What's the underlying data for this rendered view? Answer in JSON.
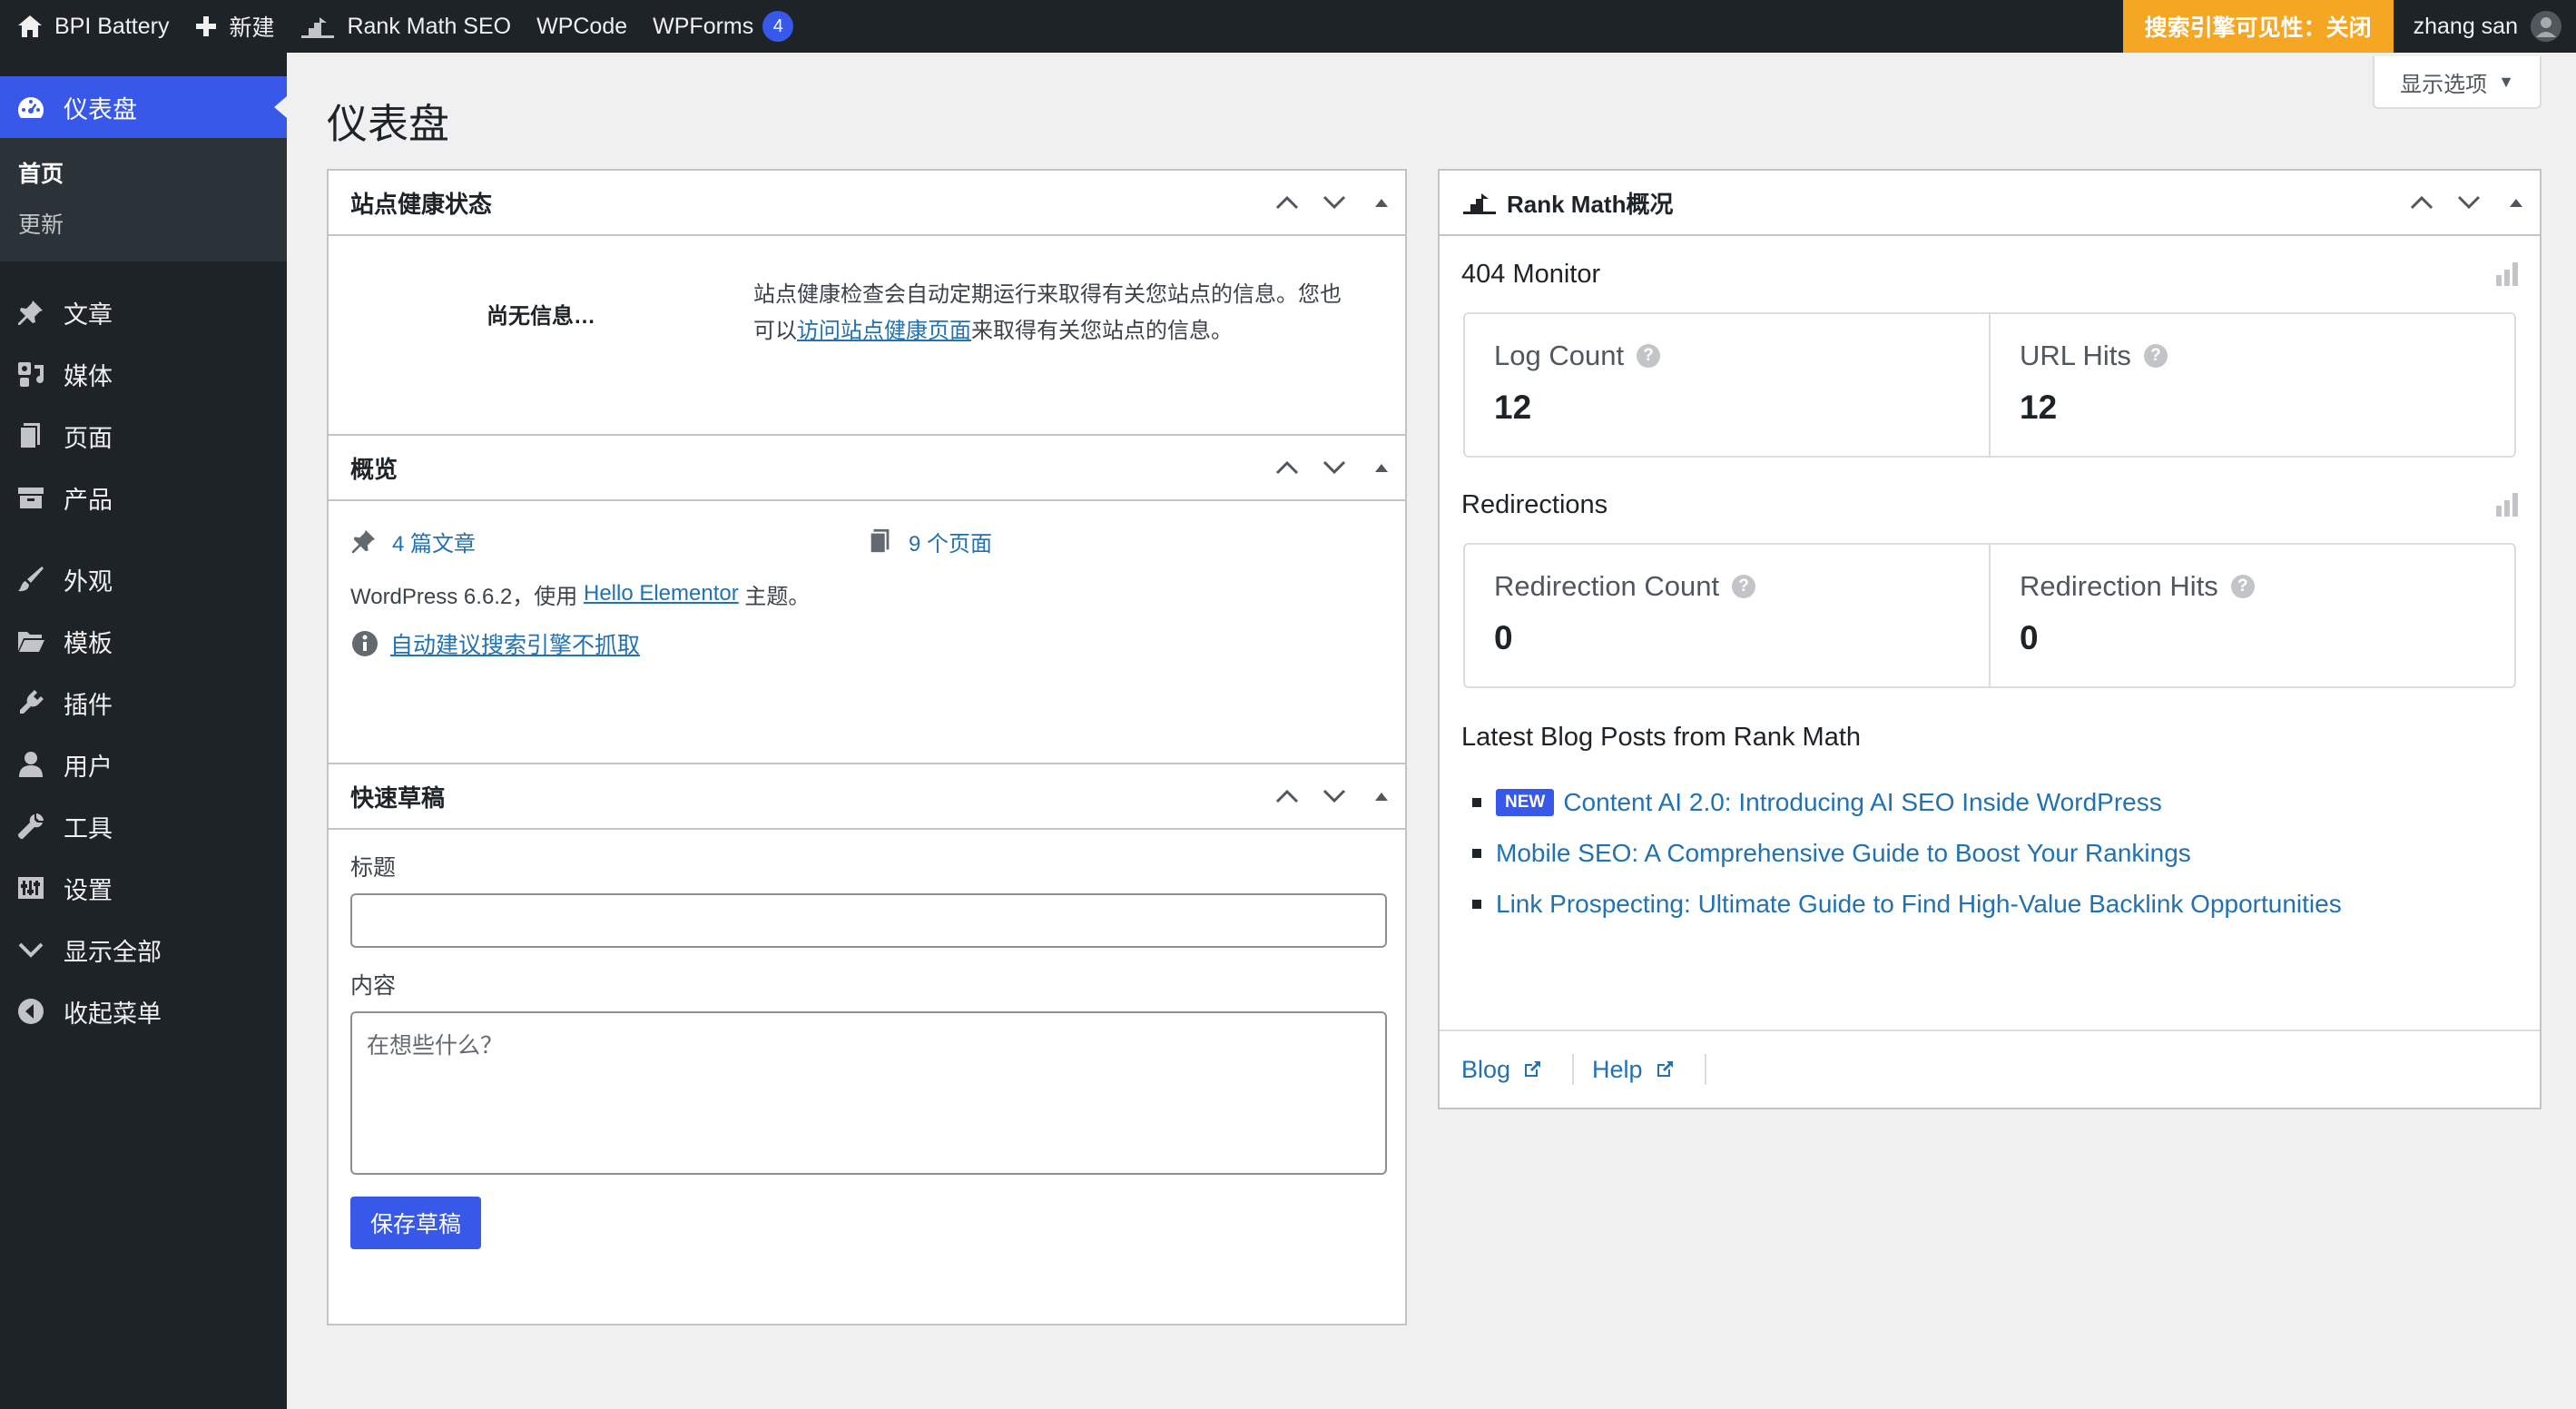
{
  "adminbar": {
    "site_name": "BPI Battery",
    "new_label": "新建",
    "rank_math_label": "Rank Math SEO",
    "wpcode_label": "WPCode",
    "wpforms_label": "WPForms",
    "wpforms_count": "4",
    "seo_visibility": "搜索引擎可见性：关闭",
    "user_name": "zhang san"
  },
  "sidebar": {
    "dashboard": "仪表盘",
    "sub_home": "首页",
    "sub_updates": "更新",
    "items": [
      {
        "label": "文章",
        "icon": "pin-icon"
      },
      {
        "label": "媒体",
        "icon": "media-icon"
      },
      {
        "label": "页面",
        "icon": "pages-icon"
      },
      {
        "label": "产品",
        "icon": "archive-icon"
      },
      {
        "label": "外观",
        "icon": "brush-icon"
      },
      {
        "label": "模板",
        "icon": "folder-icon"
      },
      {
        "label": "插件",
        "icon": "plugin-icon"
      },
      {
        "label": "用户",
        "icon": "user-icon"
      },
      {
        "label": "工具",
        "icon": "wrench-icon"
      },
      {
        "label": "设置",
        "icon": "settings-icon"
      },
      {
        "label": "显示全部",
        "icon": "chevron-down-icon"
      },
      {
        "label": "收起菜单",
        "icon": "collapse-icon"
      }
    ]
  },
  "page": {
    "title": "仪表盘",
    "screen_options": "显示选项"
  },
  "site_health": {
    "title": "站点健康状态",
    "no_info": "尚无信息…",
    "desc_1": "站点健康检查会自动定期运行来取得有关您站点的信息。您也",
    "desc_2": "可以",
    "desc_link": "访问站点健康页面",
    "desc_3": "来取得有关您站点的信息。"
  },
  "overview": {
    "title": "概览",
    "posts": "4 篇文章",
    "pages": "9 个页面",
    "wp_version_1": "WordPress 6.6.2，使用 ",
    "theme": "Hello Elementor",
    "wp_version_2": " 主题。",
    "notice": "自动建议搜索引擎不抓取"
  },
  "quick_draft": {
    "title": "快速草稿",
    "title_label": "标题",
    "content_label": "内容",
    "content_placeholder": "在想些什么？",
    "save_label": "保存草稿"
  },
  "rank_math": {
    "title": "Rank Math概况",
    "monitor_title": "404 Monitor",
    "log_count_label": "Log Count",
    "log_count_value": "12",
    "url_hits_label": "URL Hits",
    "url_hits_value": "12",
    "redirections_title": "Redirections",
    "redirection_count_label": "Redirection Count",
    "redirection_count_value": "0",
    "redirection_hits_label": "Redirection Hits",
    "redirection_hits_value": "0",
    "latest_title": "Latest Blog Posts from Rank Math",
    "new_tag": "NEW",
    "posts": [
      "Content AI 2.0: Introducing AI SEO Inside WordPress",
      "Mobile SEO: A Comprehensive Guide to Boost Your Rankings",
      "Link Prospecting: Ultimate Guide to Find High-Value Backlink Opportunities"
    ],
    "footer_blog": "Blog",
    "footer_help": "Help"
  },
  "colors": {
    "accent": "#3858e9",
    "adminbar_bg": "#1d2327",
    "seo_warning": "#f5a623",
    "link": "#2271b1"
  }
}
